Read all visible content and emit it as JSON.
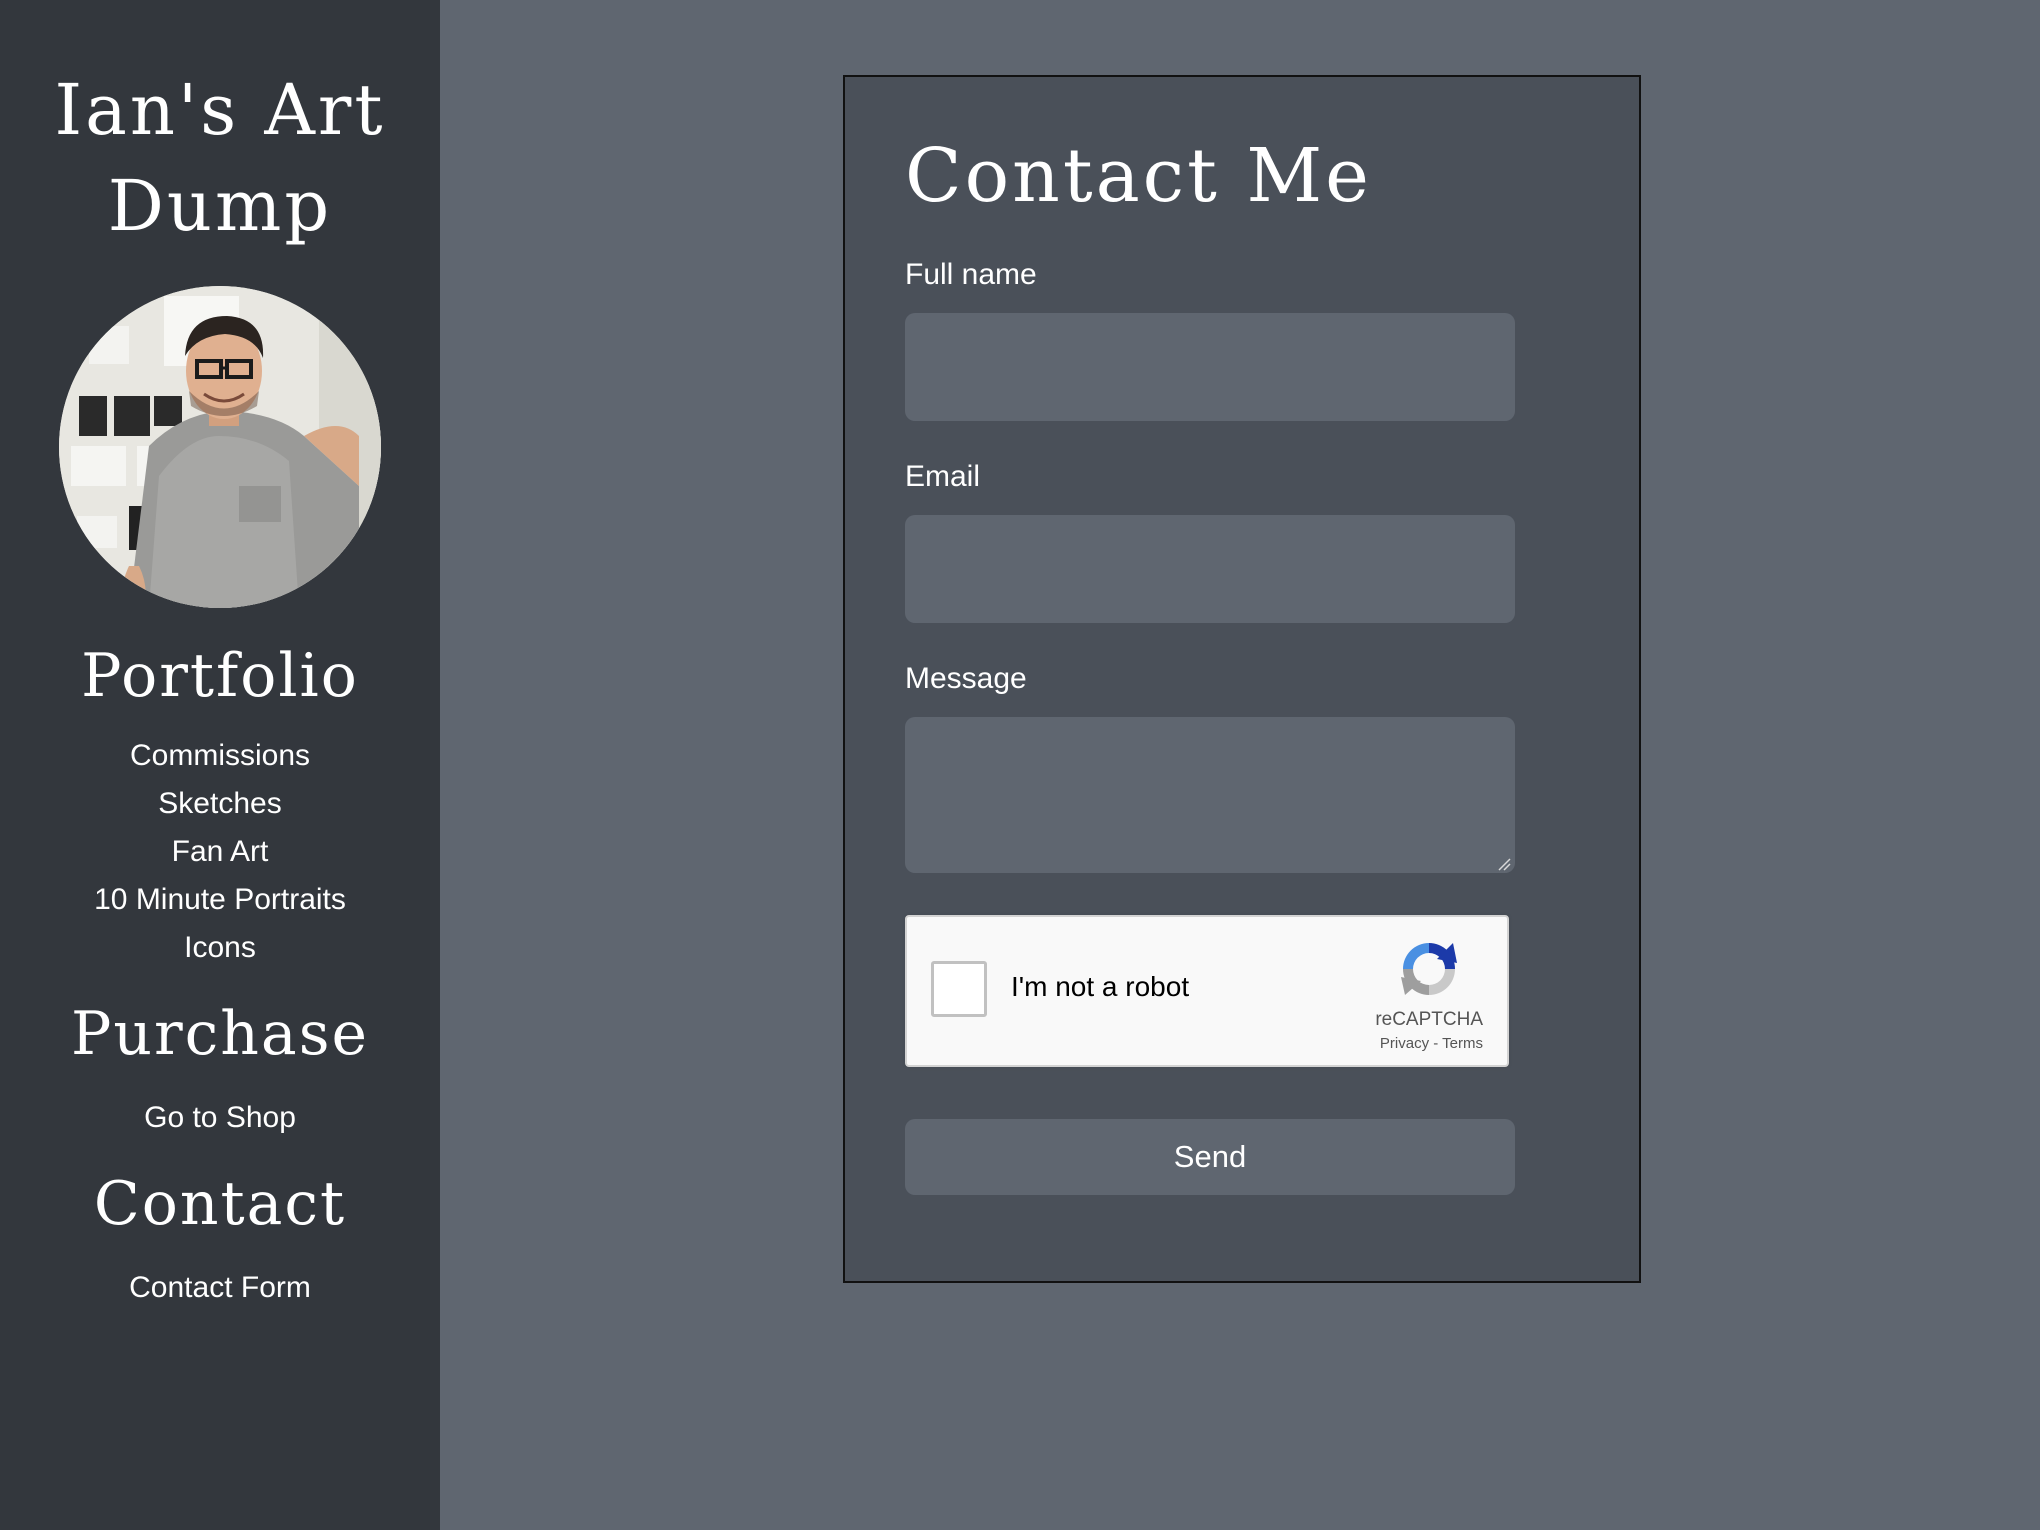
{
  "sidebar": {
    "site_title_line1": "Ian's Art",
    "site_title_line2": "Dump",
    "sections": {
      "portfolio": {
        "heading": "Portfolio",
        "items": [
          "Commissions",
          "Sketches",
          "Fan Art",
          "10 Minute Portraits",
          "Icons"
        ]
      },
      "purchase": {
        "heading": "Purchase",
        "items": [
          "Go to Shop"
        ]
      },
      "contact": {
        "heading": "Contact",
        "items": [
          "Contact Form"
        ]
      }
    }
  },
  "form": {
    "title": "Contact Me",
    "full_name_label": "Full name",
    "full_name_value": "",
    "email_label": "Email",
    "email_value": "",
    "message_label": "Message",
    "message_value": "",
    "recaptcha": {
      "label": "I'm not a robot",
      "brand": "reCAPTCHA",
      "privacy": "Privacy",
      "separator": " - ",
      "terms": "Terms",
      "logo_icon": "recaptcha-logo-icon"
    },
    "send_label": "Send"
  },
  "colors": {
    "page_bg": "#5f6670",
    "sidebar_bg": "#33373d",
    "card_bg": "#4a5059",
    "input_bg": "#5f6670",
    "text": "#ffffff"
  }
}
